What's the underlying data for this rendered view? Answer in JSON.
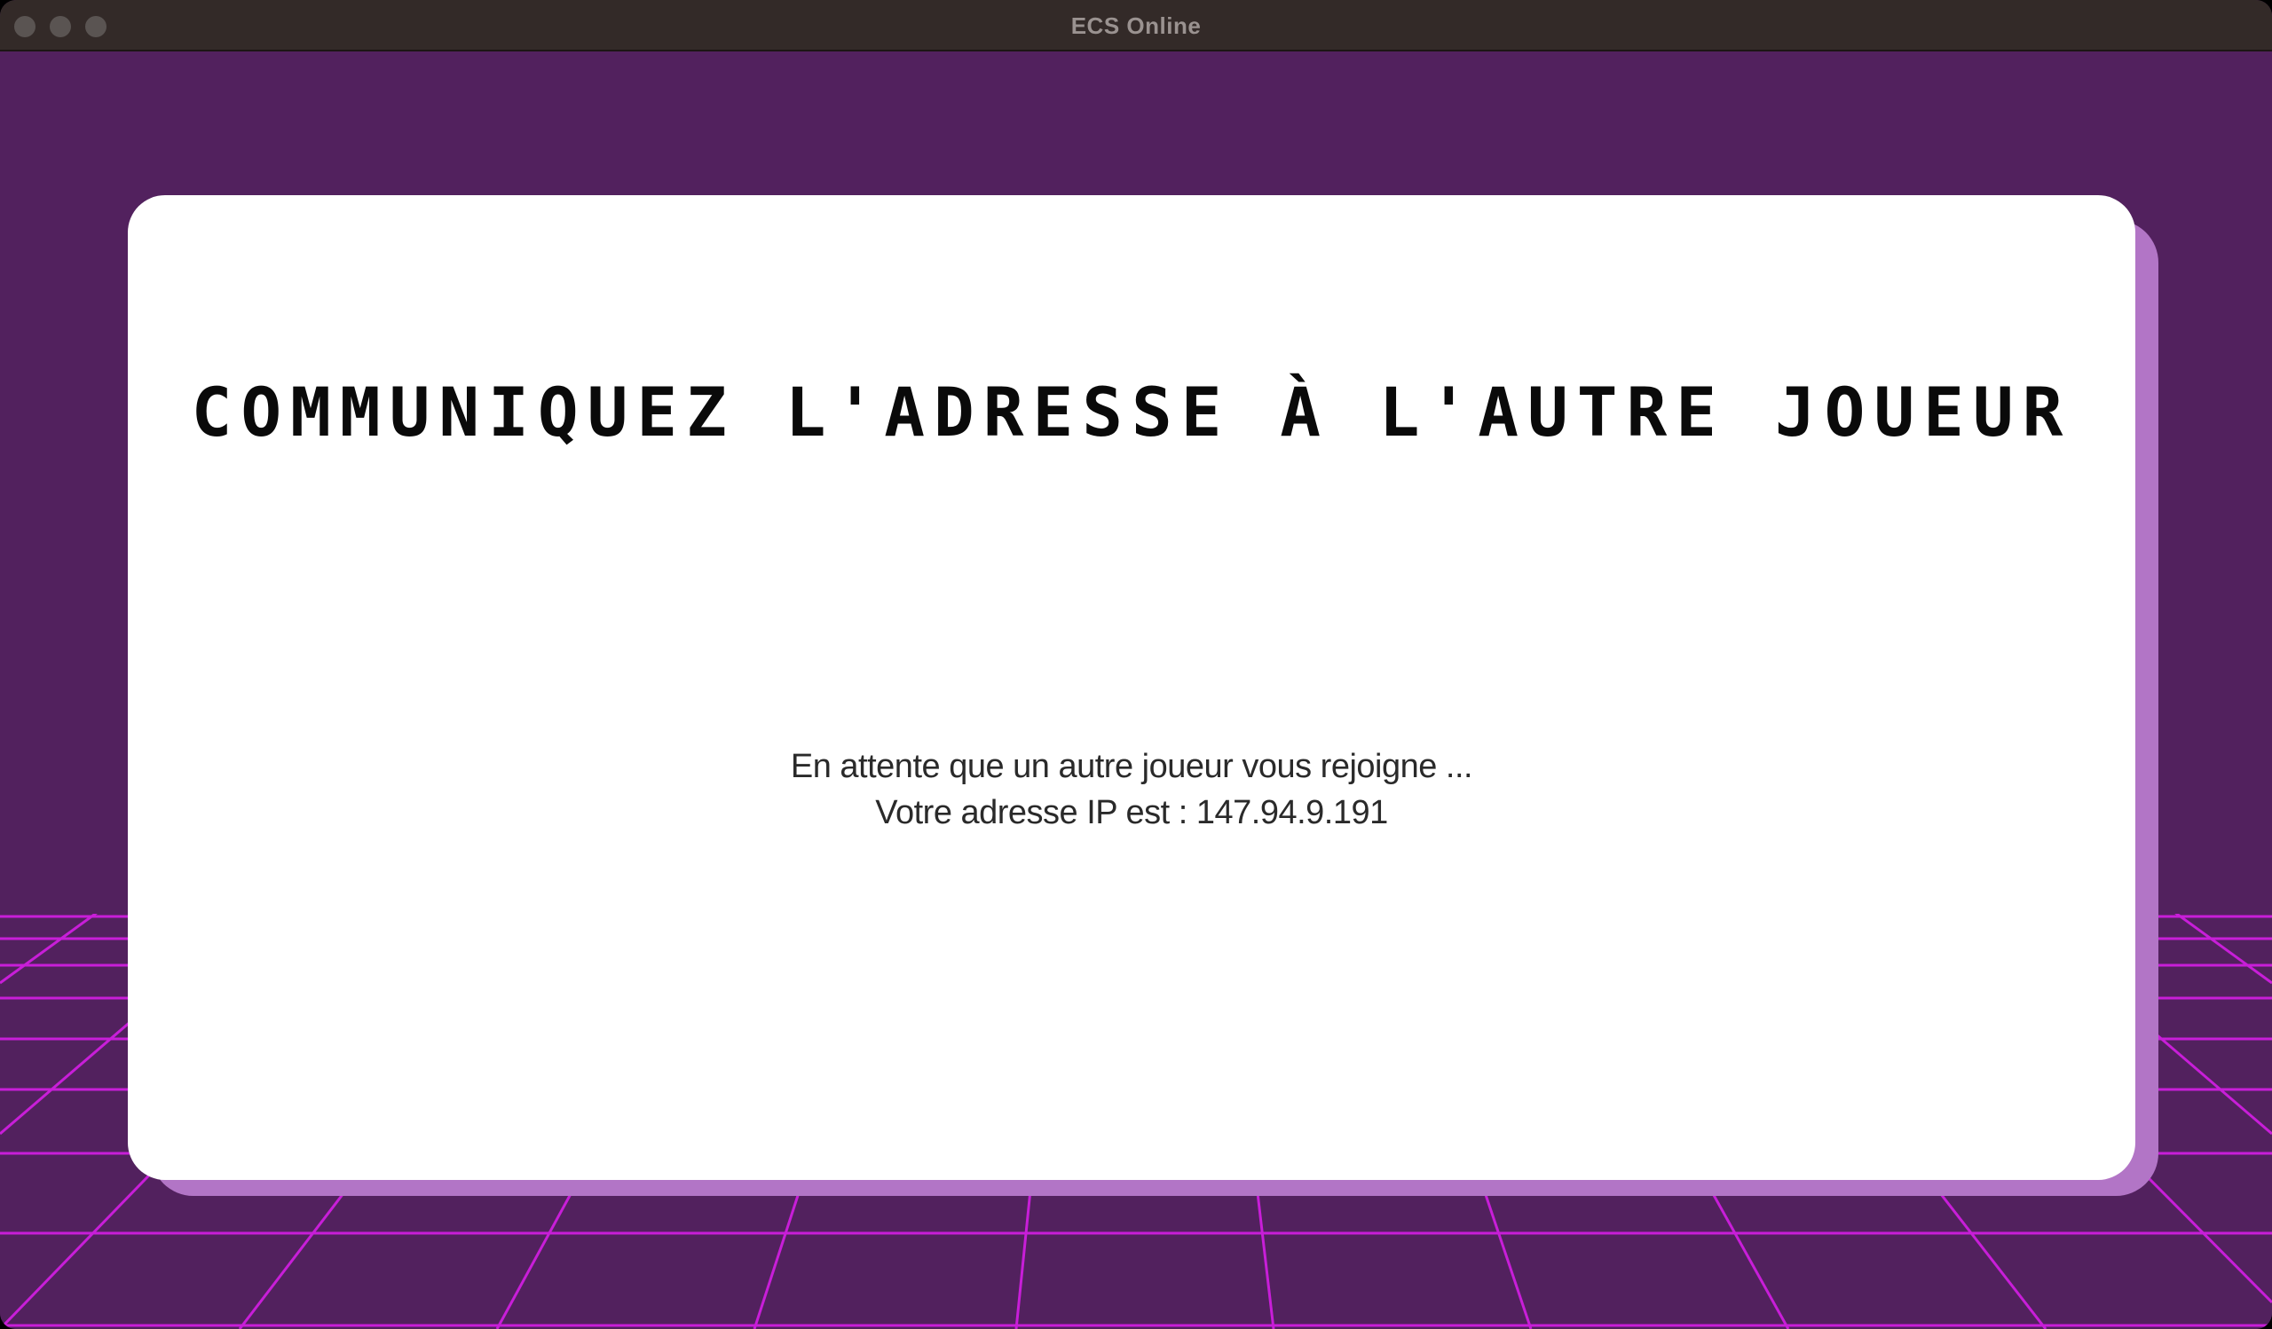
{
  "window": {
    "title": "ECS Online"
  },
  "card": {
    "heading": "COMMUNIQUEZ L'ADRESSE À L'AUTRE JOUEUR",
    "waiting_text": "En attente que un autre joueur vous rejoigne ...",
    "ip_text": "Votre adresse IP est : 147.94.9.191"
  },
  "colors": {
    "background": "#52215e",
    "grid_lines": "#c81ed8",
    "card": "#ffffff",
    "card_shadow": "#b275c6",
    "titlebar": "#332a28"
  }
}
